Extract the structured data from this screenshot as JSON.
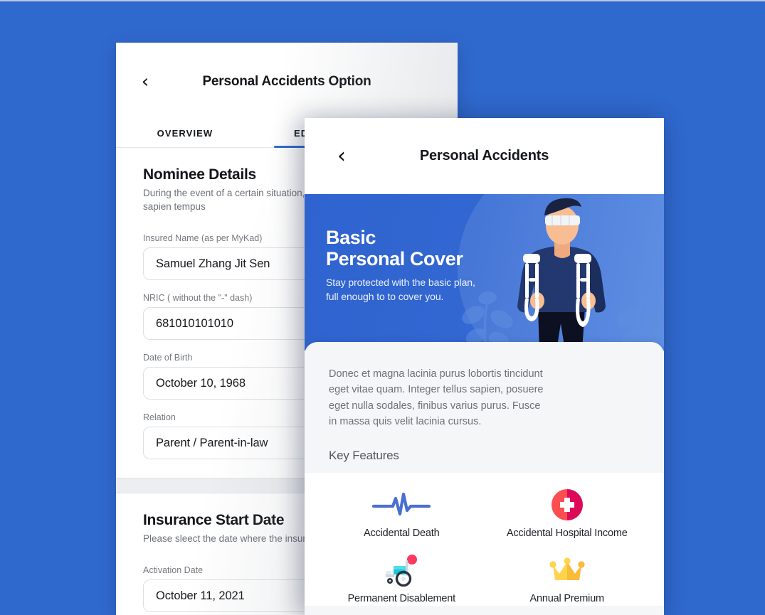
{
  "canvas": {
    "background_color": "#3069ce"
  },
  "left_panel": {
    "back_icon": "chevron-left-icon",
    "title": "Personal Accidents Option",
    "tabs": [
      {
        "label": "OVERVIEW",
        "active": false
      },
      {
        "label": "EDIT",
        "active": true
      }
    ],
    "sections": [
      {
        "heading": "Nominee Details",
        "subtext": "During the event of a certain situation, Aenean sit amet sapien tempus",
        "fields": [
          {
            "label": "Insured Name (as per MyKad)",
            "value": "Samuel Zhang Jit Sen"
          },
          {
            "label": "NRIC ( without the \"-\" dash)",
            "value": "681010101010"
          },
          {
            "label": "Date of Birth",
            "value": "October 10, 1968"
          },
          {
            "label": "Relation",
            "value": "Parent / Parent-in-law"
          }
        ]
      },
      {
        "heading": "Insurance Start Date",
        "subtext": "Please sleect the date where the insurance",
        "fields": [
          {
            "label": "Activation Date",
            "value": "October 11, 2021"
          }
        ]
      }
    ]
  },
  "right_panel": {
    "back_icon": "chevron-left-icon",
    "title": "Personal Accidents",
    "hero": {
      "title_line1": "Basic",
      "title_line2": "Personal Cover",
      "subtitle_line1": "Stay protected with the basic plan,",
      "subtitle_line2": "full enough to to cover you.",
      "illustration": "injured-man-with-crutches-illustration",
      "accent_color": "#3267d2"
    },
    "description": "Donec et magna lacinia purus lobortis tincidunt eget vitae quam. Integer tellus sapien, posuere eget nulla sodales, finibus varius purus. Fusce in massa quis velit lacinia cursus.",
    "key_features_heading": "Key Features",
    "features": [
      {
        "label": "Accidental Death",
        "icon": "heartbeat-pulse-icon",
        "color": "#4a6fd0"
      },
      {
        "label": "Accidental Hospital Income",
        "icon": "medical-cross-circle-icon",
        "color": "#e8254e"
      },
      {
        "label": "Permanent Disablement",
        "icon": "wheelchair-icon",
        "color": "#18c6d8"
      },
      {
        "label": "Annual Premium",
        "icon": "crown-icon",
        "color": "#ffc93c"
      }
    ]
  }
}
